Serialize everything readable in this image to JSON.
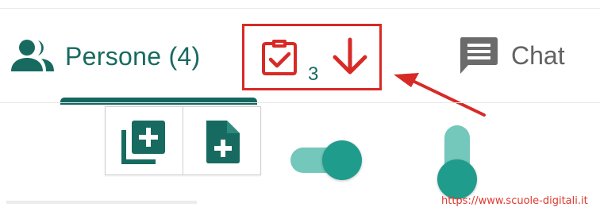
{
  "tabs": {
    "people": {
      "label": "Persone (4)",
      "icon": "people-icon"
    },
    "raised_hands": {
      "count": "3",
      "icon": "clipboard-check-icon",
      "arrow_icon": "arrow-down-icon"
    },
    "chat": {
      "label": "Chat",
      "icon": "chat-icon"
    }
  },
  "toolbar": {
    "buttons": [
      {
        "icon": "add-multiple-icon"
      },
      {
        "icon": "add-document-icon"
      }
    ]
  },
  "toggles": [
    {
      "orientation": "horizontal",
      "state": "on"
    },
    {
      "orientation": "vertical",
      "state": "on"
    }
  ],
  "watermark": "https://www.scuole-digitali.it",
  "colors": {
    "primary": "#176a60",
    "accent": "#d72a27",
    "toggle_track": "#73c7bb",
    "toggle_thumb": "#1f9c8c",
    "inactive": "#626262"
  }
}
